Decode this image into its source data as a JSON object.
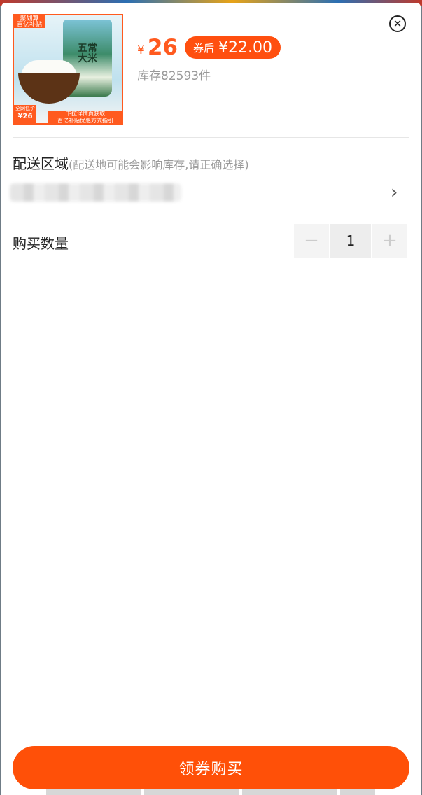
{
  "product": {
    "thumb_badge": "聚划算\n百亿补贴",
    "thumb_bag_title": "五常大米",
    "thumb_price_label": "全网低价",
    "thumb_price": "¥26",
    "thumb_banner": "下拉详情页获取\n百亿补贴优惠方式指引",
    "currency": "¥",
    "price": "26",
    "coupon_label": "券后",
    "coupon_price": "¥22.00",
    "stock": "库存82593件"
  },
  "delivery": {
    "title": "配送区域",
    "hint": "(配送地可能会影响库存,请正确选择)"
  },
  "quantity": {
    "title": "购买数量",
    "minus": "−",
    "value": "1",
    "plus": "+"
  },
  "actions": {
    "buy_label": "领券购买"
  },
  "colors": {
    "accent": "#ff5008"
  }
}
